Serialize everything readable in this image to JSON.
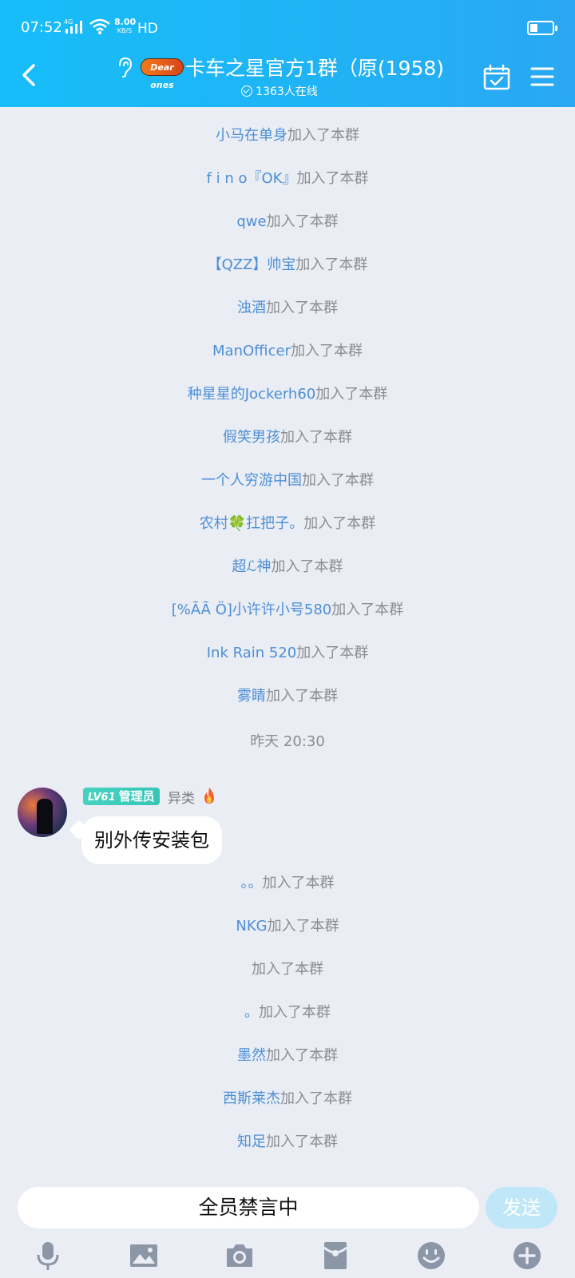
{
  "status_bar": {
    "time": "07:52",
    "network": "4G",
    "speed_value": "8.00",
    "speed_unit": "KB/S",
    "hd": "HD",
    "battery_level": 0.35
  },
  "header": {
    "logo_text": "Dear ones",
    "title": "卡车之星官方1群（原(1958)",
    "online_text": "1363人在线"
  },
  "join_suffix": "加入了本群",
  "joins_before": [
    {
      "nick": "小马在单身"
    },
    {
      "nick": "f i n o『OK』"
    },
    {
      "nick": "qwe"
    },
    {
      "nick": "【QZZ】帅宝"
    },
    {
      "nick": "浊酒"
    },
    {
      "nick": "ManOfficer"
    },
    {
      "nick": "种星星的Jockerh60"
    },
    {
      "nick": "假笑男孩"
    },
    {
      "nick": "一个人穷游中国"
    },
    {
      "nick": "农村🍀扛把子。"
    },
    {
      "nick": "超ℒ神"
    },
    {
      "nick": "[%ĀĀ Ö]小许许小号580"
    },
    {
      "nick": "Ink Rain 520"
    },
    {
      "nick": "雾睛"
    }
  ],
  "time_divider": "昨天 20:30",
  "message": {
    "level": "LV61",
    "role": "管理员",
    "sender": "异类",
    "text": "别外传安装包"
  },
  "joins_after": [
    {
      "nick": "。。"
    },
    {
      "nick": "NKG"
    },
    {
      "nick": ""
    },
    {
      "nick": "。"
    },
    {
      "nick": "墨然"
    },
    {
      "nick": "西斯莱杰"
    },
    {
      "nick": "知足"
    }
  ],
  "input": {
    "muted_text": "全员禁言中",
    "send_label": "发送"
  },
  "toolbar": {
    "icons": [
      "microphone-icon",
      "image-icon",
      "camera-icon",
      "red-packet-icon",
      "emoji-icon",
      "plus-icon"
    ]
  }
}
